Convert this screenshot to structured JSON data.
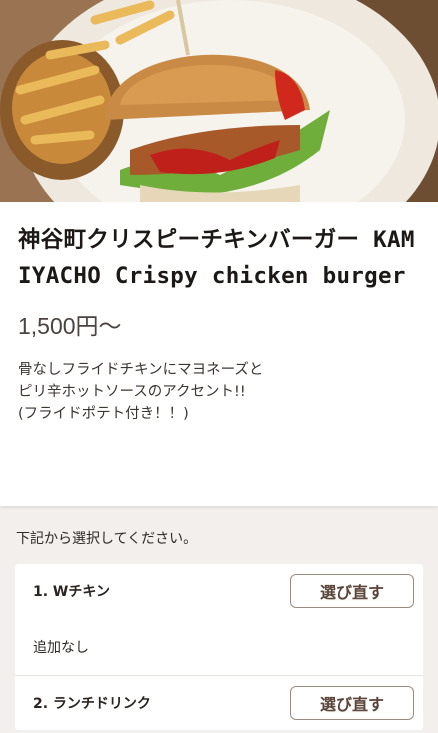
{
  "product": {
    "title": "神谷町クリスピーチキンバーガー KAMIYACHO Crispy chicken burger",
    "price": "1,500円～",
    "description": "骨なしフライドチキンにマヨネーズと\nピリ辛ホットソースのアクセント!!\n(フライドポテト付き！！)"
  },
  "options": {
    "instruction": "下記から選択してください。",
    "items": [
      {
        "label": "1. Wチキン",
        "button": "選び直す",
        "selected": "追加なし"
      },
      {
        "label": "2. ランチドリンク",
        "button": "選び直す"
      }
    ]
  },
  "colors": {
    "button_border": "#9c8a7f",
    "button_text": "#5a4338",
    "background": "#f2efec"
  }
}
